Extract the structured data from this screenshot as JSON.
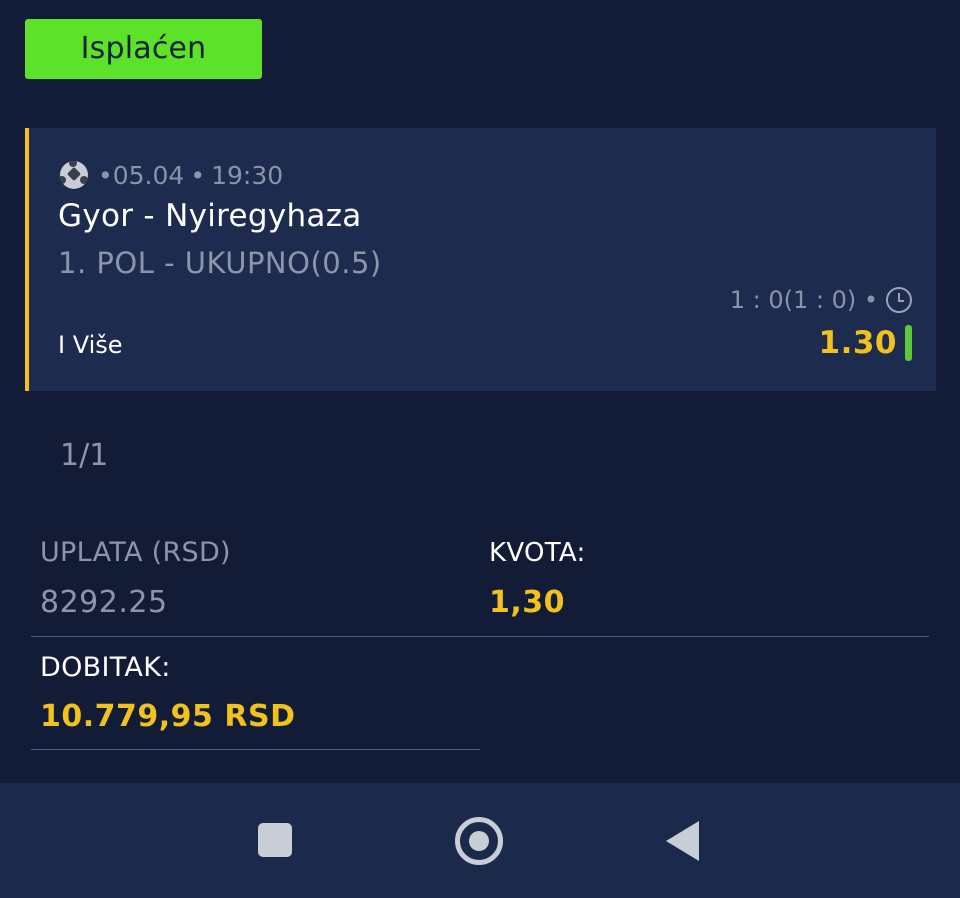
{
  "status": {
    "label": "Isplaćen",
    "color": "#5de22a"
  },
  "bet": {
    "sport_icon": "soccer-ball-icon",
    "date": "•05.04",
    "separator": "•",
    "time": "19:30",
    "match": "Gyor - Nyiregyhaza",
    "market": "1. POL - UKUPNO(0.5)",
    "score": "1 :  0(1 :  0) •",
    "score_icon": "clock-icon",
    "selection": "I Više",
    "odd": "1.30",
    "result_color": "#5dc93a"
  },
  "counter": "1/1",
  "summary": {
    "stake_label": "UPLATA (RSD)",
    "stake_value": "8292.25",
    "odds_label": "KVOTA:",
    "odds_value": "1,30",
    "win_label": "DOBITAK:",
    "win_value": "10.779,95 RSD"
  },
  "colors": {
    "background": "#121c37",
    "card": "#1d2b4e",
    "accent": "#f2c21a"
  },
  "nav": {
    "recents_icon": "square-icon",
    "home_icon": "circle-icon",
    "back_icon": "back-triangle-icon"
  }
}
